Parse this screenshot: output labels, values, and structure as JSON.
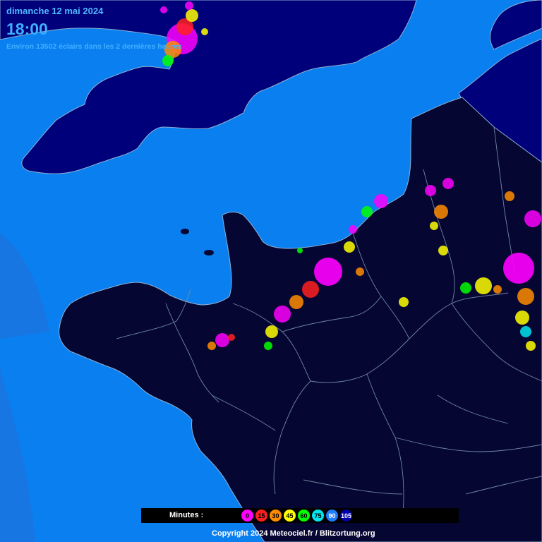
{
  "header": {
    "date": "dimanche 12 mai 2024",
    "time": "18:00",
    "strike_count_text": "Environ 13502 éclairs dans les 2 dernières heures"
  },
  "legend": {
    "label": "Minutes :",
    "steps": [
      {
        "minutes": "0",
        "color": "#ff00ff"
      },
      {
        "minutes": "15",
        "color": "#ff2020"
      },
      {
        "minutes": "30",
        "color": "#ff8c00"
      },
      {
        "minutes": "45",
        "color": "#ffff00"
      },
      {
        "minutes": "60",
        "color": "#00ff00"
      },
      {
        "minutes": "75",
        "color": "#00e5ee"
      },
      {
        "minutes": "90",
        "color": "#1e7cff"
      },
      {
        "minutes": "105",
        "color": "#0000aa"
      }
    ]
  },
  "copyright": "Copyright 2024 Meteociel.fr / Blitzortung.org",
  "colors": {
    "sea": "#0a7ff0",
    "sea_deep": "#1f6fd8",
    "land_uk": "#00007a",
    "land_fr": "#060633",
    "borders": "#6e88a0"
  }
}
